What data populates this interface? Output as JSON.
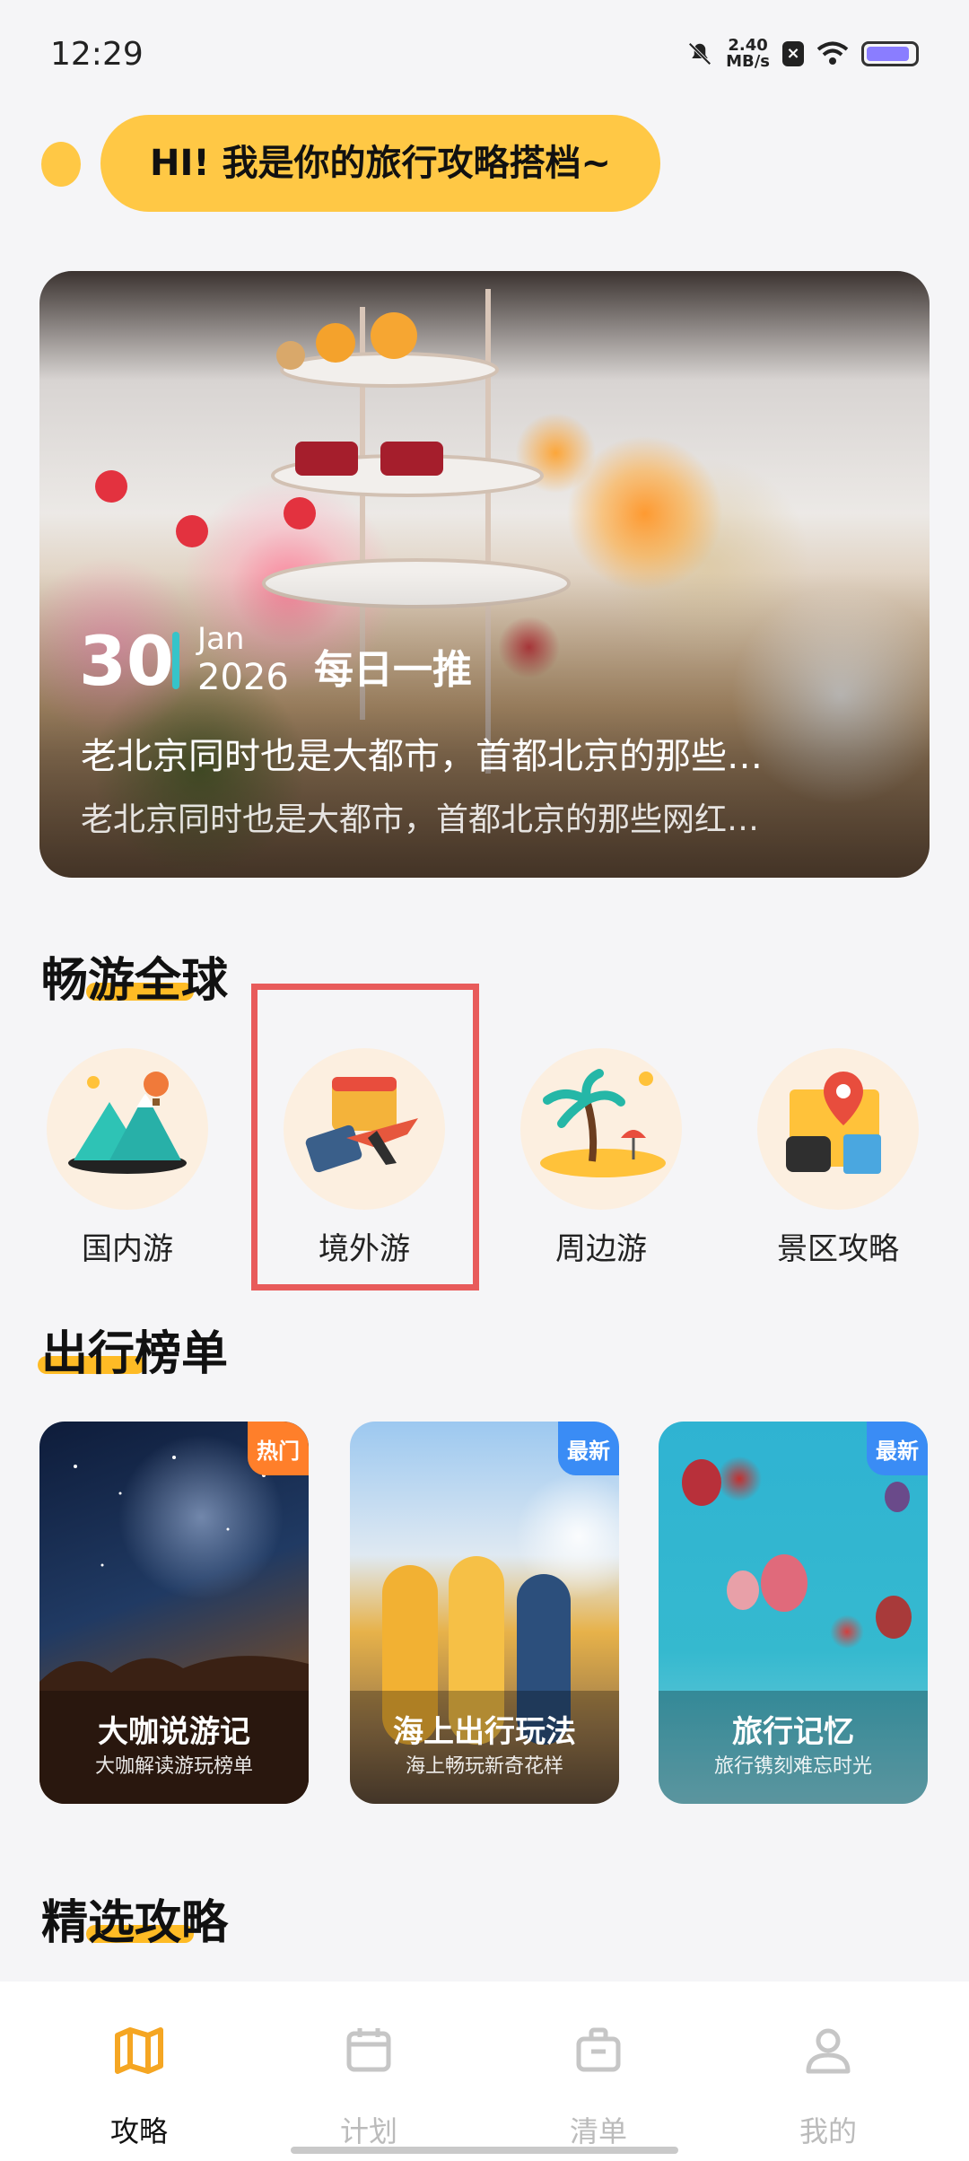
{
  "status_bar": {
    "time": "12:29",
    "net_speed_value": "2.40",
    "net_speed_unit": "MB/s",
    "icons": [
      "mute-bell-icon",
      "app-notification-icon",
      "wifi-icon",
      "battery-icon"
    ],
    "battery_level": 0.9
  },
  "greeting": {
    "text": "HI! 我是你的旅行攻略搭档~"
  },
  "hero": {
    "day": "30",
    "month": "Jan",
    "year": "2026",
    "tag": "每日一推",
    "title": "老北京同时也是大都市，首都北京的那些…",
    "subtitle": "老北京同时也是大都市，首都北京的那些网红…"
  },
  "sections": {
    "global": "畅游全球",
    "ranking": "出行榜单",
    "featured": "精选攻略"
  },
  "categories": [
    {
      "label": "国内游",
      "icon": "mountain-balloon-icon"
    },
    {
      "label": "境外游",
      "icon": "passport-plane-icon"
    },
    {
      "label": "周边游",
      "icon": "island-palm-icon"
    },
    {
      "label": "景区攻略",
      "icon": "map-pin-wallet-icon"
    }
  ],
  "ranking_cards": [
    {
      "title": "大咖说游记",
      "subtitle": "大咖解读游玩榜单",
      "badge": "热门",
      "badge_bg": "HOT"
    },
    {
      "title": "海上出行玩法",
      "subtitle": "海上畅玩新奇花样",
      "badge": "最新",
      "badge_bg": "NEW"
    },
    {
      "title": "旅行记忆",
      "subtitle": "旅行镌刻难忘时光",
      "badge": "最新",
      "badge_bg": "NEW"
    }
  ],
  "bottom_nav": [
    {
      "label": "攻略",
      "icon": "map-icon",
      "active": true
    },
    {
      "label": "计划",
      "icon": "calendar-icon",
      "active": false
    },
    {
      "label": "清单",
      "icon": "briefcase-icon",
      "active": false
    },
    {
      "label": "我的",
      "icon": "user-icon",
      "active": false
    }
  ],
  "colors": {
    "accent_yellow": "#ffc845",
    "highlight_red": "#e85b5b",
    "hot_orange": "#ff7f2a",
    "new_blue": "#3a8cf5",
    "nav_active": "#f5a623"
  }
}
